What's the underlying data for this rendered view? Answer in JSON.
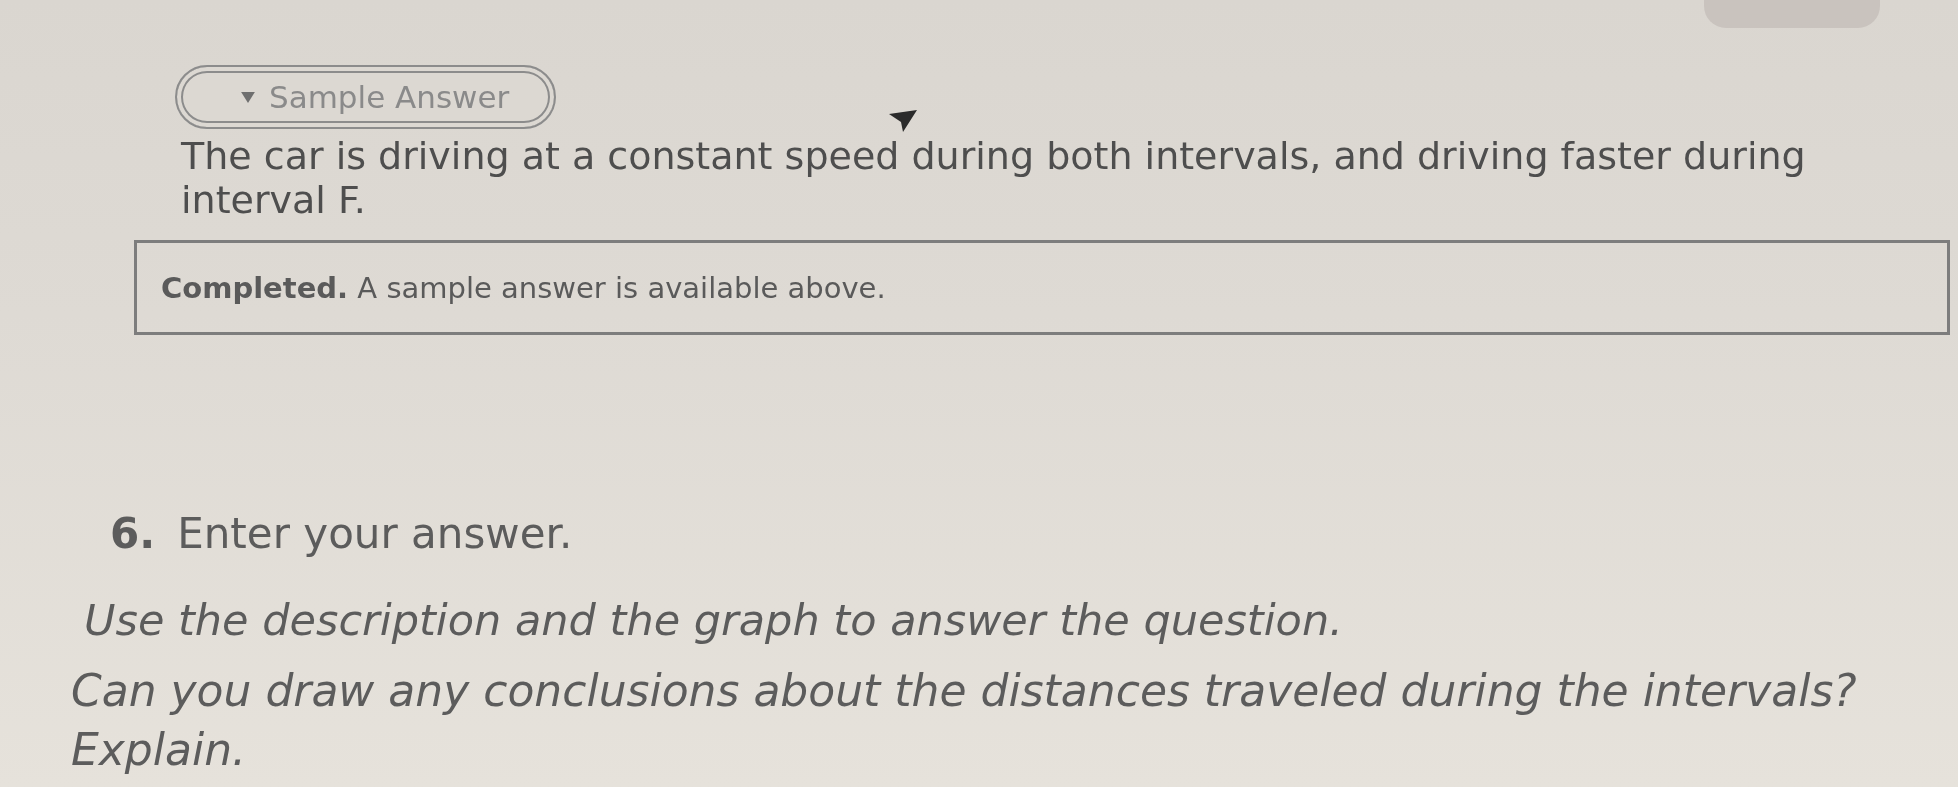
{
  "sample_answer": {
    "toggle": {
      "label": "Sample Answer",
      "expanded": true
    },
    "text": "The car is driving at a constant speed during both intervals, and driving faster during interval F."
  },
  "status": {
    "text": "**Completed.** A sample answer is available above."
  },
  "question": {
    "number": "6.",
    "prompt": "Enter your answer.",
    "instructions": "Use the description and the graph to answer the question.",
    "question": "Can you draw any conclusions about the distances traveled during the intervals? Explain."
  }
}
